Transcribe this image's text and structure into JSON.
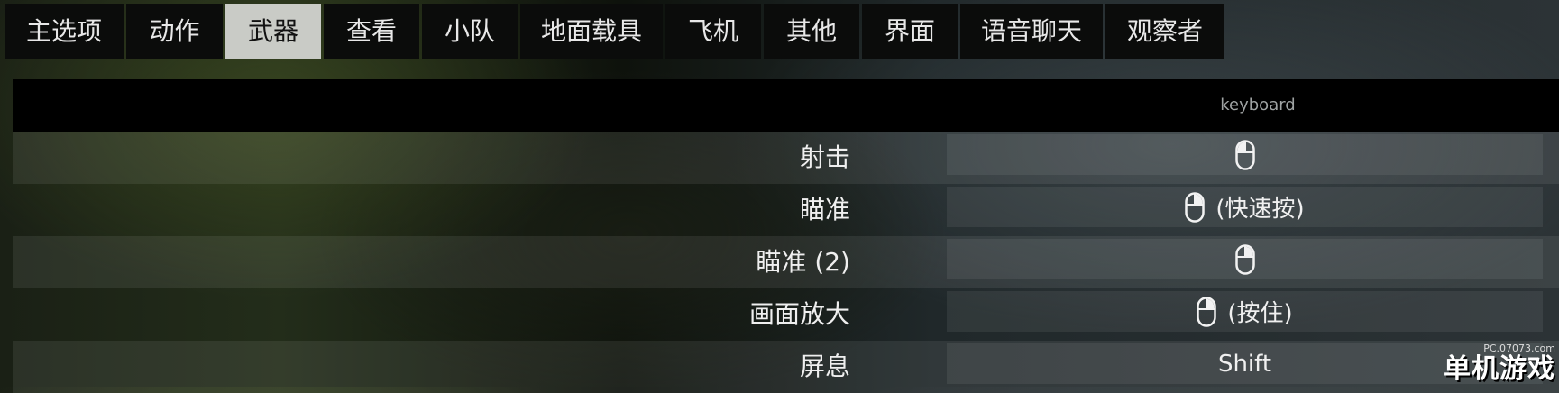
{
  "tabs": [
    {
      "label": "主选项",
      "active": false
    },
    {
      "label": "动作",
      "active": false
    },
    {
      "label": "武器",
      "active": true
    },
    {
      "label": "查看",
      "active": false
    },
    {
      "label": "小队",
      "active": false
    },
    {
      "label": "地面载具",
      "active": false
    },
    {
      "label": "飞机",
      "active": false
    },
    {
      "label": "其他",
      "active": false
    },
    {
      "label": "界面",
      "active": false
    },
    {
      "label": "语音聊天",
      "active": false
    },
    {
      "label": "观察者",
      "active": false
    }
  ],
  "table": {
    "header": {
      "column": "keyboard"
    },
    "rows": [
      {
        "action": "射击",
        "icon": "mouse-left-button-icon",
        "key_text": ""
      },
      {
        "action": "瞄准",
        "icon": "mouse-right-button-icon",
        "key_text": "(快速按)"
      },
      {
        "action": "瞄准 (2)",
        "icon": "mouse-right-button-icon",
        "key_text": ""
      },
      {
        "action": "画面放大",
        "icon": "mouse-right-button-icon",
        "key_text": "(按住)"
      },
      {
        "action": "屏息",
        "icon": "",
        "key_text": "Shift"
      }
    ]
  },
  "watermark": {
    "url": "PC.07073.com",
    "brand": "单机游戏"
  },
  "colors": {
    "active_tab_bg": "#c9cbc6",
    "tab_bg": "#0b0c0b",
    "header_bg": "#000000"
  }
}
